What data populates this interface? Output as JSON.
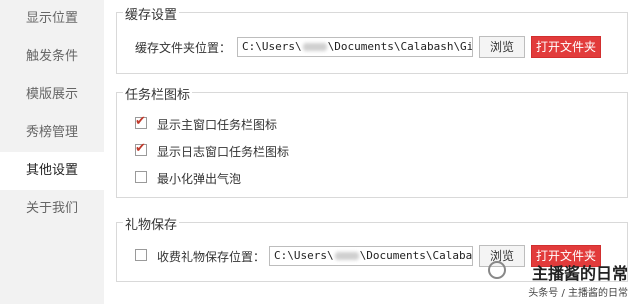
{
  "sidebar": {
    "items": [
      {
        "label": "显示位置"
      },
      {
        "label": "触发条件"
      },
      {
        "label": "模版展示"
      },
      {
        "label": "秀榜管理"
      },
      {
        "label": "其他设置",
        "active": true
      },
      {
        "label": "关于我们"
      }
    ]
  },
  "cache": {
    "title": "缓存设置",
    "folder_label": "缓存文件夹位置：",
    "path_prefix": "C:\\Users\\",
    "path_suffix": "\\Documents\\Calabash\\GiftS",
    "browse_label": "浏览",
    "open_label": "打开文件夹"
  },
  "taskbar": {
    "title": "任务栏图标",
    "options": [
      {
        "label": "显示主窗口任务栏图标",
        "checked": true
      },
      {
        "label": "显示日志窗口任务栏图标",
        "checked": true
      },
      {
        "label": "最小化弹出气泡",
        "checked": false
      }
    ]
  },
  "gift": {
    "title": "礼物保存",
    "save_label": "收费礼物保存位置：",
    "checked": false,
    "path_prefix": "C:\\Users\\",
    "path_suffix": "\\Documents\\Calabash",
    "browse_label": "浏览",
    "open_label": "打开文件夹"
  },
  "watermark": {
    "main": "主播酱的日常",
    "sub": "头条号 / 主播酱的日常"
  },
  "colors": {
    "accent_red": "#e23b3b",
    "check_red": "#c0392b",
    "sidebar_bg": "#f2f2f2"
  }
}
